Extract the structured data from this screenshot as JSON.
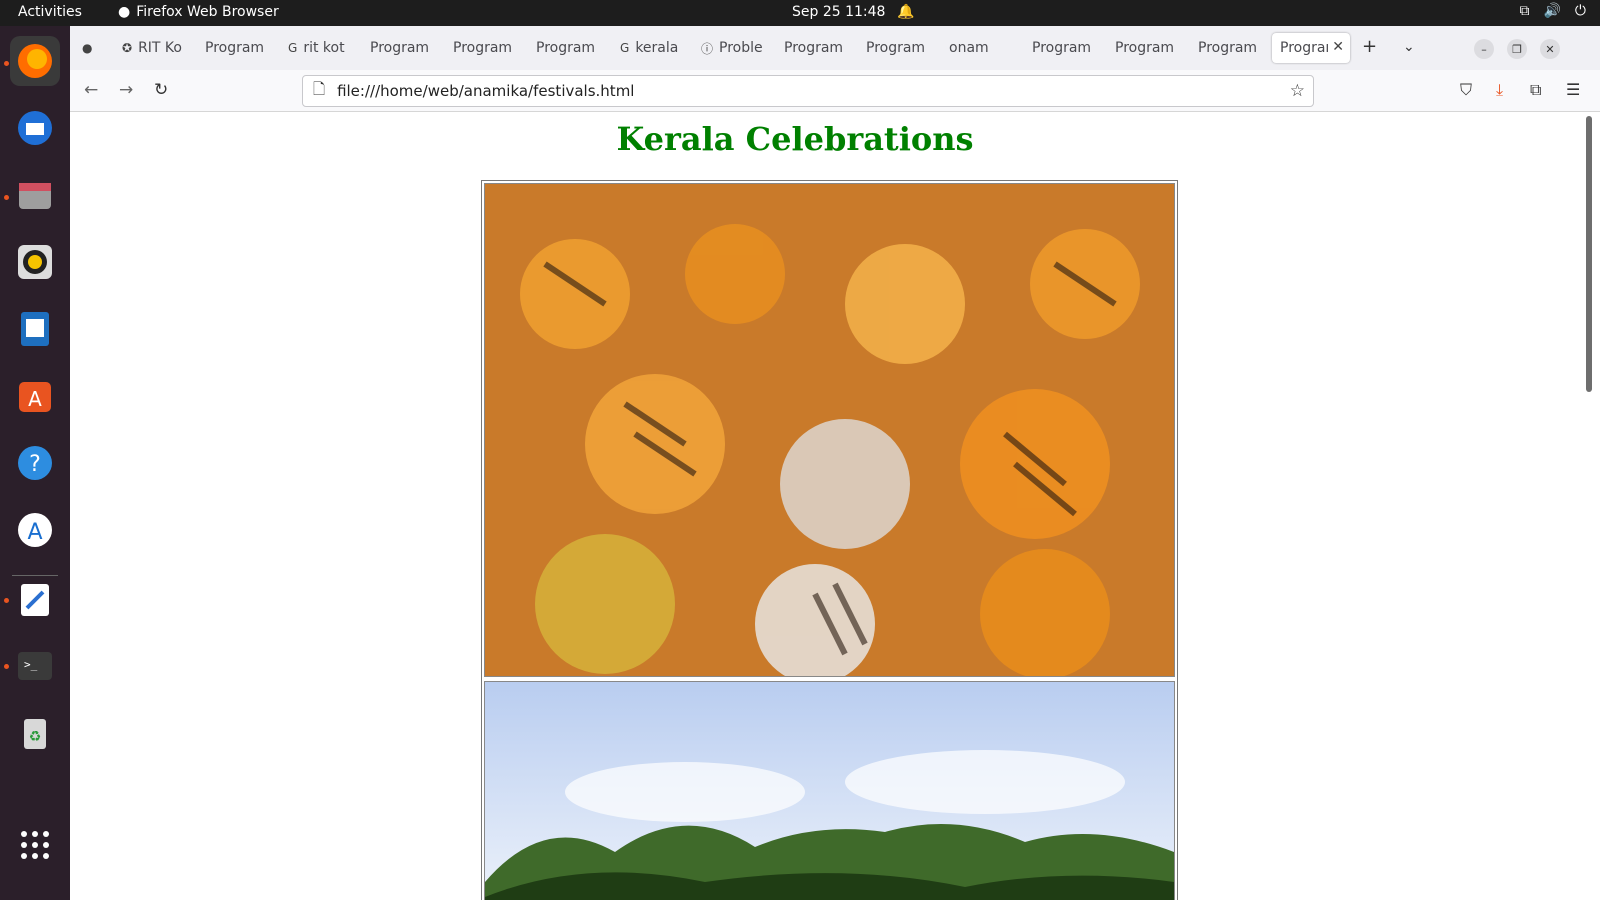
{
  "system": {
    "activities": "Activities",
    "app_name": "Firefox Web Browser",
    "clock": "Sep 25  11:48"
  },
  "browser": {
    "tabs": [
      {
        "label": "RIT Ko",
        "icon": "rit-icon"
      },
      {
        "label": "Program",
        "icon": ""
      },
      {
        "label": "rit kot",
        "icon": "google-icon"
      },
      {
        "label": "Program",
        "icon": ""
      },
      {
        "label": "Program",
        "icon": ""
      },
      {
        "label": "Program",
        "icon": ""
      },
      {
        "label": "kerala",
        "icon": "google-icon"
      },
      {
        "label": "Proble",
        "icon": "info-icon"
      },
      {
        "label": "Program",
        "icon": ""
      },
      {
        "label": "Program",
        "icon": ""
      },
      {
        "label": "onam",
        "icon": ""
      },
      {
        "label": "Program",
        "icon": ""
      },
      {
        "label": "Program",
        "icon": ""
      },
      {
        "label": "Program",
        "icon": ""
      },
      {
        "label": "Prograı",
        "icon": "",
        "active": true
      }
    ],
    "url": "file:///home/web/anamika/festivals.html"
  },
  "page": {
    "heading": "Kerala Celebrations",
    "heading_color": "#008000"
  }
}
